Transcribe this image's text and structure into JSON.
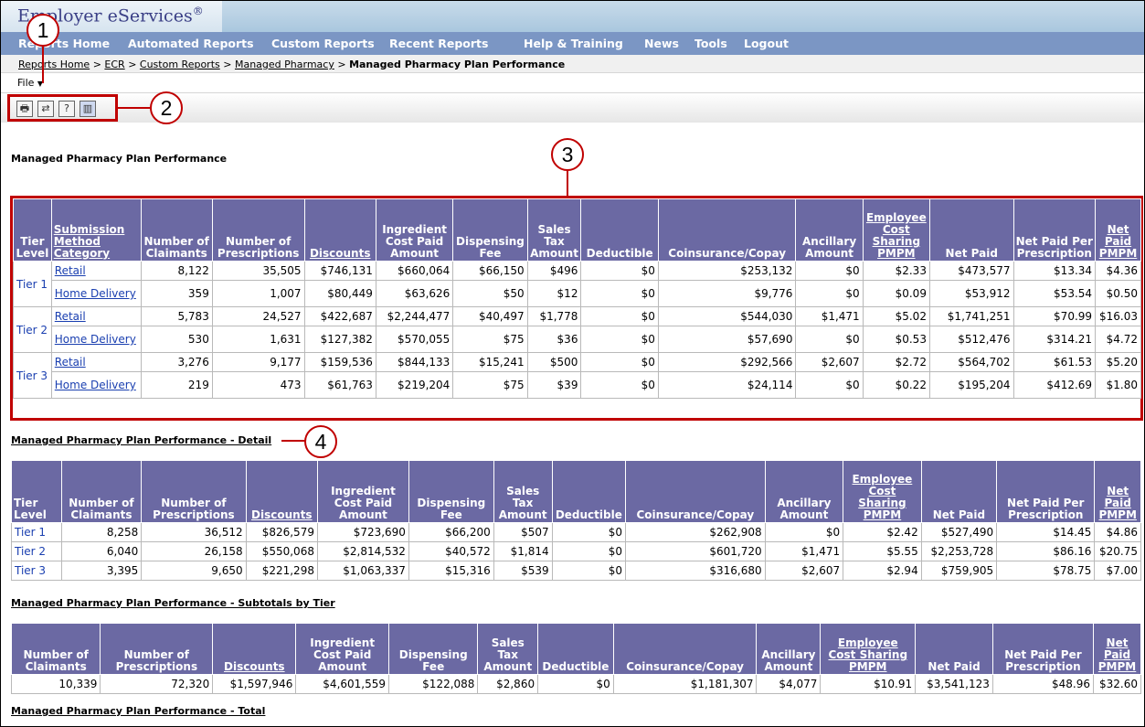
{
  "app": {
    "brand": "Employer eServices",
    "trademark": "®"
  },
  "nav": {
    "items": [
      "Reports Home",
      "Automated Reports",
      "Custom Reports",
      "Recent Reports",
      "Help & Training",
      "News",
      "Tools",
      "Logout"
    ]
  },
  "breadcrumb": {
    "links": [
      "Reports Home",
      "ECR",
      "Custom Reports",
      "Managed Pharmacy"
    ],
    "separator": ">",
    "current": "Managed Pharmacy Plan Performance"
  },
  "file_menu": {
    "label": "File"
  },
  "toolbar": {
    "icons": [
      "printer-icon",
      "export-icon",
      "help-icon",
      "chart-icon"
    ]
  },
  "callouts": [
    "1",
    "2",
    "3",
    "4"
  ],
  "report_title": "Managed Pharmacy Plan Performance",
  "summary_table": {
    "headers": [
      "Tier Level",
      "Submission Method Category",
      "Number of Claimants",
      "Number of Prescriptions",
      "Discounts",
      "Ingredient Cost Paid Amount",
      "Dispensing Fee",
      "Sales Tax Amount",
      "Deductible",
      "Coinsurance/Copay",
      "Ancillary Amount",
      "Employee Cost Sharing PMPM",
      "Net Paid",
      "Net Paid Per Prescription",
      "Net Paid PMPM"
    ],
    "rows": [
      [
        "Tier 1",
        "Retail",
        "8,122",
        "35,505",
        "$746,131",
        "$660,064",
        "$66,150",
        "$496",
        "$0",
        "$253,132",
        "$0",
        "$2.33",
        "$473,577",
        "$13.34",
        "$4.36"
      ],
      [
        "",
        "Home Delivery",
        "359",
        "1,007",
        "$80,449",
        "$63,626",
        "$50",
        "$12",
        "$0",
        "$9,776",
        "$0",
        "$0.09",
        "$53,912",
        "$53.54",
        "$0.50"
      ],
      [
        "Tier 2",
        "Retail",
        "5,783",
        "24,527",
        "$422,687",
        "$2,244,477",
        "$40,497",
        "$1,778",
        "$0",
        "$544,030",
        "$1,471",
        "$5.02",
        "$1,741,251",
        "$70.99",
        "$16.03"
      ],
      [
        "",
        "Home Delivery",
        "530",
        "1,631",
        "$127,382",
        "$570,055",
        "$75",
        "$36",
        "$0",
        "$57,690",
        "$0",
        "$0.53",
        "$512,476",
        "$314.21",
        "$4.72"
      ],
      [
        "Tier 3",
        "Retail",
        "3,276",
        "9,177",
        "$159,536",
        "$844,133",
        "$15,241",
        "$500",
        "$0",
        "$292,566",
        "$2,607",
        "$2.72",
        "$564,702",
        "$61.53",
        "$5.20"
      ],
      [
        "",
        "Home Delivery",
        "219",
        "473",
        "$61,763",
        "$219,204",
        "$75",
        "$39",
        "$0",
        "$24,114",
        "$0",
        "$0.22",
        "$195,204",
        "$412.69",
        "$1.80"
      ]
    ]
  },
  "detail_title": "Managed Pharmacy Plan Performance - Detail",
  "detail_table": {
    "headers": [
      "Tier Level",
      "Number of Claimants",
      "Number of Prescriptions",
      "Discounts",
      "Ingredient Cost Paid Amount",
      "Dispensing Fee",
      "Sales Tax Amount",
      "Deductible",
      "Coinsurance/Copay",
      "Ancillary Amount",
      "Employee Cost Sharing PMPM",
      "Net Paid",
      "Net Paid Per Prescription",
      "Net Paid PMPM"
    ],
    "rows": [
      [
        "Tier 1",
        "8,258",
        "36,512",
        "$826,579",
        "$723,690",
        "$66,200",
        "$507",
        "$0",
        "$262,908",
        "$0",
        "$2.42",
        "$527,490",
        "$14.45",
        "$4.86"
      ],
      [
        "Tier 2",
        "6,040",
        "26,158",
        "$550,068",
        "$2,814,532",
        "$40,572",
        "$1,814",
        "$0",
        "$601,720",
        "$1,471",
        "$5.55",
        "$2,253,728",
        "$86.16",
        "$20.75"
      ],
      [
        "Tier 3",
        "3,395",
        "9,650",
        "$221,298",
        "$1,063,337",
        "$15,316",
        "$539",
        "$0",
        "$316,680",
        "$2,607",
        "$2.94",
        "$759,905",
        "$78.75",
        "$7.00"
      ]
    ]
  },
  "subtotals_title": "Managed Pharmacy Plan Performance - Subtotals by Tier",
  "subtotals_table": {
    "headers": [
      "Number of Claimants",
      "Number of Prescriptions",
      "Discounts",
      "Ingredient Cost Paid Amount",
      "Dispensing Fee",
      "Sales Tax Amount",
      "Deductible",
      "Coinsurance/Copay",
      "Ancillary Amount",
      "Employee Cost Sharing PMPM",
      "Net Paid",
      "Net Paid Per Prescription",
      "Net Paid PMPM"
    ],
    "rows": [
      [
        "10,339",
        "72,320",
        "$1,597,946",
        "$4,601,559",
        "$122,088",
        "$2,860",
        "$0",
        "$1,181,307",
        "$4,077",
        "$10.91",
        "$3,541,123",
        "$48.96",
        "$32.60"
      ]
    ]
  },
  "total_title": "Managed Pharmacy Plan Performance - Total"
}
